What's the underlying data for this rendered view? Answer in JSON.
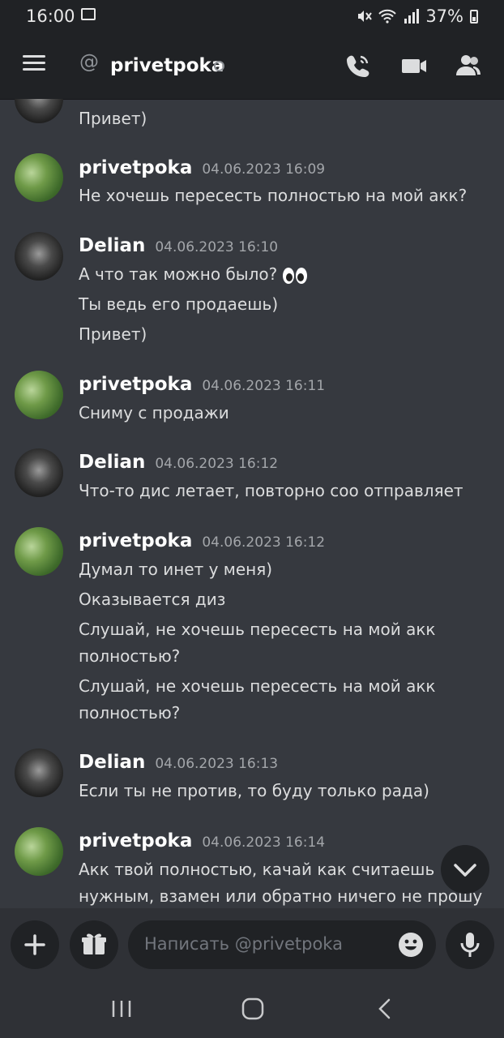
{
  "status_bar": {
    "time": "16:00",
    "battery": "37%"
  },
  "header": {
    "channel": "privetpoka"
  },
  "messages": [
    {
      "lines": [
        "Привет)"
      ]
    },
    {
      "author": "privetpoka",
      "time": "04.06.2023 16:09",
      "lines": [
        "Не хочешь пересесть полностью на мой акк?"
      ]
    },
    {
      "author": "Delian",
      "time": "04.06.2023 16:10",
      "lines": [
        "А что так можно было?",
        "Ты ведь его продаешь)",
        "Привет)"
      ]
    },
    {
      "author": "privetpoka",
      "time": "04.06.2023 16:11",
      "lines": [
        "Сниму с продажи"
      ]
    },
    {
      "author": "Delian",
      "time": "04.06.2023 16:12",
      "lines": [
        "Что-то дис летает, повторно соо отправляет"
      ]
    },
    {
      "author": "privetpoka",
      "time": "04.06.2023 16:12",
      "lines": [
        "Думал то инет у меня)",
        "Оказывается диз",
        "Слушай, не хочешь пересесть на мой акк",
        "полностью?",
        "Слушай, не хочешь пересесть на мой акк",
        "полностью?"
      ]
    },
    {
      "author": "Delian",
      "time": "04.06.2023 16:13",
      "lines": [
        "Если ты не против, то буду только рада)"
      ]
    },
    {
      "author": "privetpoka",
      "time": "04.06.2023 16:14",
      "lines": [
        "Акк твой полностью, качай как считаешь",
        "нужным, взамен или обратно ничего не прошу"
      ]
    }
  ],
  "composer": {
    "placeholder": "Написать @privetpoka"
  }
}
